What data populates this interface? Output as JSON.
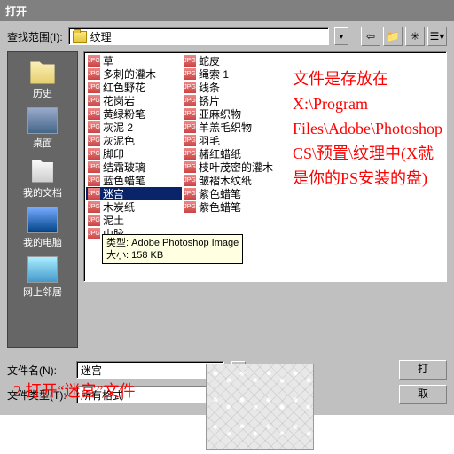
{
  "title": "打开",
  "lookin_label": "查找范围(I):",
  "lookin_value": "纹理",
  "places": [
    {
      "label": "历史",
      "cls": "place-history"
    },
    {
      "label": "桌面",
      "cls": "place-desktop"
    },
    {
      "label": "我的文档",
      "cls": "place-docs"
    },
    {
      "label": "我的电脑",
      "cls": "place-computer"
    },
    {
      "label": "网上邻居",
      "cls": "place-network"
    }
  ],
  "columns": [
    [
      "草",
      "多刺的灌木",
      "红色野花",
      "花岗岩",
      "黄绿粉笔",
      "灰泥 2",
      "灰泥色",
      "脚印",
      "结霜玻璃",
      "蓝色蜡笔",
      "迷宫",
      "木炭纸",
      "泥土",
      "山脉"
    ],
    [
      "蛇皮",
      "绳索 1",
      "线条",
      "锈片",
      "亚麻织物",
      "羊羔毛织物",
      "羽毛",
      "赭红蜡纸",
      "枝叶茂密的灌木",
      "皱褶木纹纸",
      "紫色蜡笔",
      "紫色蜡笔"
    ]
  ],
  "selected": "迷宫",
  "tooltip": {
    "type_label": "类型:",
    "type": "Adobe Photoshop Image",
    "size_label": "大小:",
    "size": "158 KB"
  },
  "filename_label": "文件名(N):",
  "filename_value": "迷宫",
  "filetype_label": "文件类型(T):",
  "filetype_value": "所有格式",
  "open_btn": "打",
  "cancel_btn": "取",
  "annotation1": "文件是存放在X:\\Program Files\\Adobe\\Photoshop CS\\预置\\纹理中(X就是你的PS安装的盘)",
  "annotation2": "2.打开“迷宫”文件"
}
